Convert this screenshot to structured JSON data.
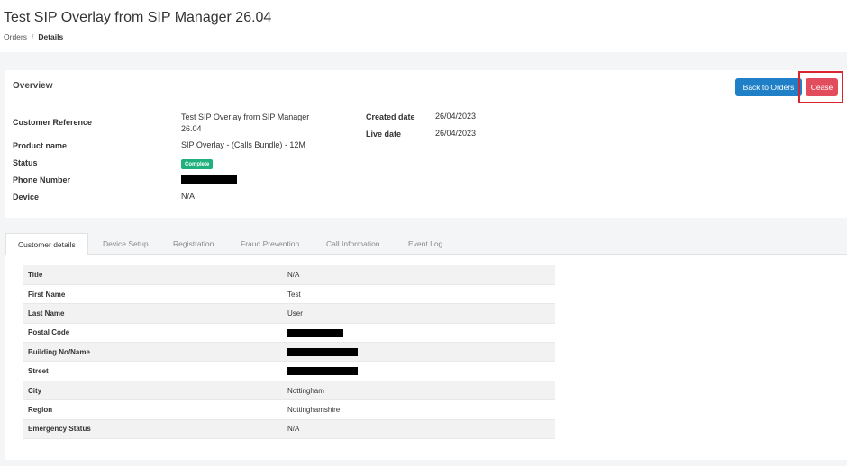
{
  "header": {
    "title": "Test SIP Overlay from SIP Manager 26.04",
    "breadcrumb": {
      "parent": "Orders",
      "separator": "/",
      "current": "Details"
    }
  },
  "overview": {
    "title": "Overview",
    "buttons": {
      "back": "Back to Orders",
      "cease": "Cease"
    },
    "fields_left": [
      {
        "label": "Customer Reference",
        "value_line1": "Test SIP Overlay from SIP Manager",
        "value_line2": "26.04"
      },
      {
        "label": "Product name",
        "value": "SIP Overlay - (Calls Bundle) - 12M"
      },
      {
        "label": "Status",
        "badge": "Complete",
        "badge_color": "#1fb07d"
      },
      {
        "label": "Phone Number",
        "redacted": true
      },
      {
        "label": "Device",
        "value": "N/A"
      }
    ],
    "fields_right": [
      {
        "label": "Created date",
        "value": "26/04/2023"
      },
      {
        "label": "Live date",
        "value": "26/04/2023"
      }
    ]
  },
  "tabs": [
    {
      "label": "Customer details",
      "active": true
    },
    {
      "label": "Device Setup",
      "active": false
    },
    {
      "label": "Registration",
      "active": false
    },
    {
      "label": "Fraud Prevention",
      "active": false
    },
    {
      "label": "Call Information",
      "active": false
    },
    {
      "label": "Event Log",
      "active": false
    }
  ],
  "customer_details": [
    {
      "label": "Title",
      "value": "N/A"
    },
    {
      "label": "First Name",
      "value": "Test"
    },
    {
      "label": "Last Name",
      "value": "User"
    },
    {
      "label": "Postal Code",
      "value": "",
      "redacted": true
    },
    {
      "label": "Building No/Name",
      "value": "",
      "redacted": true
    },
    {
      "label": "Street",
      "value": "",
      "redacted": true
    },
    {
      "label": "City",
      "value": "Nottingham"
    },
    {
      "label": "Region",
      "value": "Nottinghamshire"
    },
    {
      "label": "Emergency Status",
      "value": "N/A"
    }
  ],
  "colors": {
    "primary": "#1f7fc7",
    "danger": "#e24d5e",
    "highlight": "#d9252f",
    "success": "#1fb07d"
  }
}
